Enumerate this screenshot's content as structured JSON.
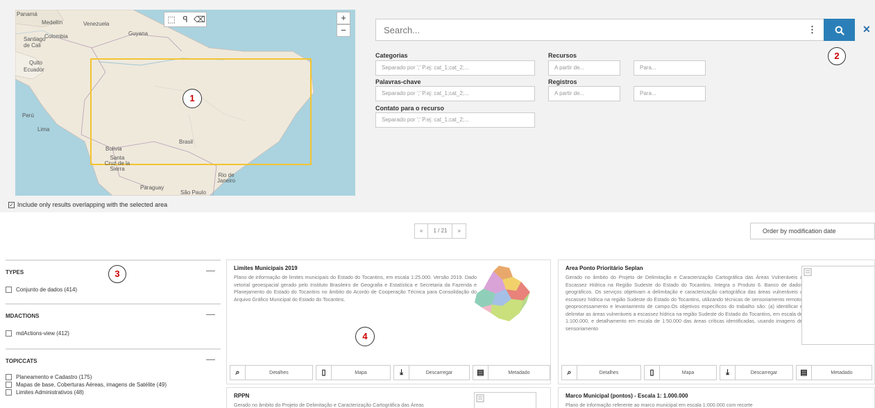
{
  "map": {
    "tools": [
      "⬚",
      "ꟼ",
      "⌫"
    ],
    "zoom_in": "+",
    "zoom_out": "−",
    "labels": [
      {
        "text": "Panamá"
      },
      {
        "text": "Medellín"
      },
      {
        "text": "Venezuela"
      },
      {
        "text": "Guyana"
      },
      {
        "text": "Santiago de Cali"
      },
      {
        "text": "Colombia"
      },
      {
        "text": "Quito"
      },
      {
        "text": "Ecuador"
      },
      {
        "text": "Perú"
      },
      {
        "text": "Lima"
      },
      {
        "text": "Brasil"
      },
      {
        "text": "Bolivia"
      },
      {
        "text": "Santa Cruz de la Sierra"
      },
      {
        "text": "Rio de Janeiro"
      },
      {
        "text": "Paraguay"
      },
      {
        "text": "São Paulo"
      }
    ],
    "overlap_checkbox_label": "Include only results overlapping with the selected area",
    "overlap_checked": true
  },
  "markers": [
    "1",
    "2",
    "3",
    "4"
  ],
  "search": {
    "placeholder": "Search...",
    "menu_glyph": "⋮",
    "search_icon": "🔍",
    "clear_icon": "✕"
  },
  "filters": {
    "categorias": {
      "label": "Categorias",
      "placeholder": "Separado por ';'     P.ej: cat_1;cat_2;..."
    },
    "palavras": {
      "label": "Palavras-chave",
      "placeholder": "Separado por ';'     P.ej: cat_1;cat_2;..."
    },
    "contato": {
      "label": "Contato para o recurso",
      "placeholder": "Separado por ';'     P.ej: cat_1;cat_2;..."
    },
    "recursos": {
      "label": "Recursos",
      "from": "A partir de...",
      "to": "Para..."
    },
    "registros": {
      "label": "Registros",
      "from": "A partir de...",
      "to": "Para..."
    }
  },
  "pager": {
    "prev": "«",
    "page": "1 / 21",
    "next": "»"
  },
  "order": {
    "value": "Order by modification date"
  },
  "facets": [
    {
      "title": "TYPES",
      "collapse": "—",
      "items": [
        "Conjunto de dados (414)"
      ]
    },
    {
      "title": "MDACTIONS",
      "collapse": "—",
      "items": [
        "mdActions-view (412)"
      ]
    },
    {
      "title": "TOPICCATS",
      "collapse": "—",
      "items": [
        "Planeamento e Cadastro (175)",
        "Mapas de base, Coberturas Aéreas, imagens de Satélite (49)",
        "Limites Administrativos (48)"
      ]
    }
  ],
  "results": [
    {
      "title": "Limites Municipais 2019",
      "abstract": "Plano de informação de limites municipais do Estado do Tocantins, em escala 1:25.000. Versão 2019. Dado vetorial geoespacial gerado pelo Instituto Brasileiro de Geografia e Estatística e Secretaria da Fazenda e Planejamento do Estado do Tocantins no âmbito do Acordo de Cooperação Técnica para Consolidação do Arquivo Gráfico Municipal do Estado do Tocantins."
    },
    {
      "title": "Area Ponto Prioritário Seplan",
      "abstract": "Gerado no âmbito do Projeto de Delimitação e Caracterização Cartográfica das Áreas Vulneráveis a Escassez Hídrica na Região Sudeste do Estado do Tocantins. Integra o Produto 6. Banco de dados geográficos. Os serviços objetivam a delimitação e caracterização cartográfica das áreas vulneráveis a escassez hídrica na região Sudeste do Estado do Tocantins, utilizando técnicas de sensoriamento remoto, geoprocessamento e levantamento de campo.Os objetivos específicos do trabalho são: (a) identificar e delimitar as áreas vulneráveis a escassez hídrica na região Sudeste do Estado do Tocantins, em escala de 1:100.000, e detalhamento em escala de 1:50.000 das áreas críticas identificadas, usando imagens de sensoriamento"
    },
    {
      "title": "RPPN",
      "abstract": "Gerado no âmbito do Projeto de Delimitação e Caracterização Cartográfica das Áreas"
    },
    {
      "title": "Marco Municipal (pontos) - Escala 1: 1.000.000",
      "abstract": "Plano de informação referente ao marco municipal em escala 1:000.000 com recorte"
    }
  ],
  "actions": {
    "details": "Detalhes",
    "map": "Mapa",
    "download": "Descarregar",
    "metadata": "Metadado"
  }
}
